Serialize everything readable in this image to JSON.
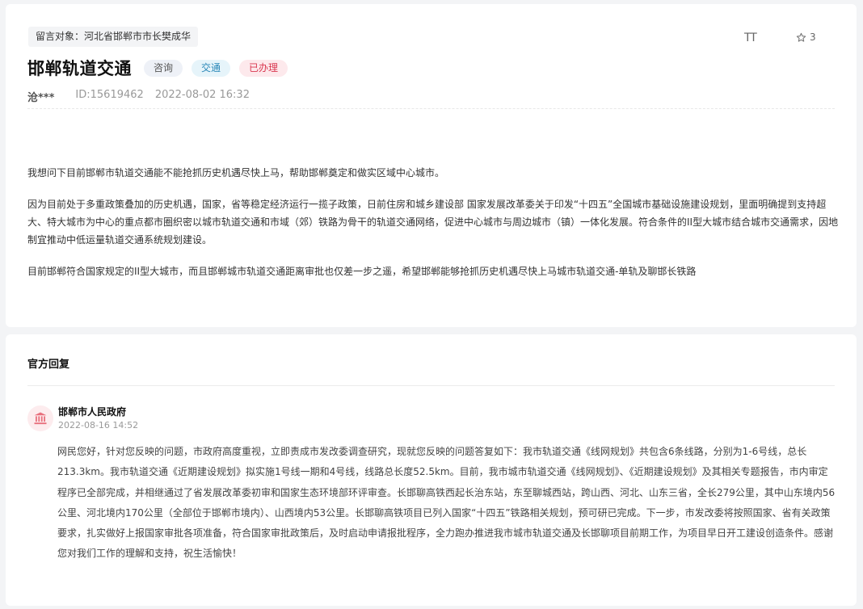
{
  "question": {
    "target_label": "留言对象：",
    "target_name": "河北省邯郸市市长樊成华",
    "font_toggle": "TT",
    "star_count": "3",
    "title": "邯郸轨道交通",
    "tags": [
      {
        "label": "咨询",
        "kind": "consult"
      },
      {
        "label": "交通",
        "kind": "traffic"
      },
      {
        "label": "已办理",
        "kind": "done"
      }
    ],
    "author": "沧***",
    "id_text": "ID:15619462",
    "datetime": "2022-08-02 16:32",
    "paragraphs": [
      "我想问下目前邯郸市轨道交通能不能抢抓历史机遇尽快上马，帮助邯郸奠定和做实区域中心城市。",
      "因为目前处于多重政策叠加的历史机遇，国家，省等稳定经济运行一揽子政策，日前住房和城乡建设部   国家发展改革委关于印发“十四五”全国城市基础设施建设规划，里面明确提到支持超大、特大城市为中心的重点都市圈织密以城市轨道交通和市域（郊）铁路为骨干的轨道交通网络，促进中心城市与周边城市（镇）一体化发展。符合条件的II型大城市结合城市交通需求，因地制宜推动中低运量轨道交通系统规划建设。",
      "目前邯郸符合国家规定的II型大城市，而且邯郸城市轨道交通距离审批也仅差一步之遥，希望邯郸能够抢抓历史机遇尽快上马城市轨道交通-单轨及聊邯长铁路"
    ]
  },
  "reply": {
    "heading": "官方回复",
    "responder": "邯郸市人民政府",
    "datetime": "2022-08-16 14:52",
    "text": "网民您好，针对您反映的问题，市政府高度重视，立即责成市发改委调查研究，现就您反映的问题答复如下：我市轨道交通《线网规划》共包含6条线路，分别为1-6号线，总长213.3km。我市轨道交通《近期建设规划》拟实施1号线一期和4号线，线路总长度52.5km。目前，我市城市轨道交通《线网规划》、《近期建设规划》及其相关专题报告，市内审定程序已全部完成，并相继通过了省发展改革委初审和国家生态环境部环评审查。长邯聊高铁西起长治东站，东至聊城西站，跨山西、河北、山东三省，全长279公里，其中山东境内56公里、河北境内170公里（全部位于邯郸市境内）、山西境内53公里。长邯聊高铁项目已列入国家“十四五”铁路相关规划，预可研已完成。下一步，市发改委将按照国家、省有关政策要求，扎实做好上报国家审批各项准备，符合国家审批政策后，及时启动申请报批程序，全力跑办推进我市城市轨道交通及长邯聊项目前期工作，为项目早日开工建设创造条件。感谢您对我们工作的理解和支持，祝生活愉快！"
  },
  "colors": {
    "tag_consult_bg": "#eef1f7",
    "tag_traffic_text": "#2a88b8",
    "tag_done_text": "#d9364f",
    "avatar_icon": "#e8707d"
  }
}
